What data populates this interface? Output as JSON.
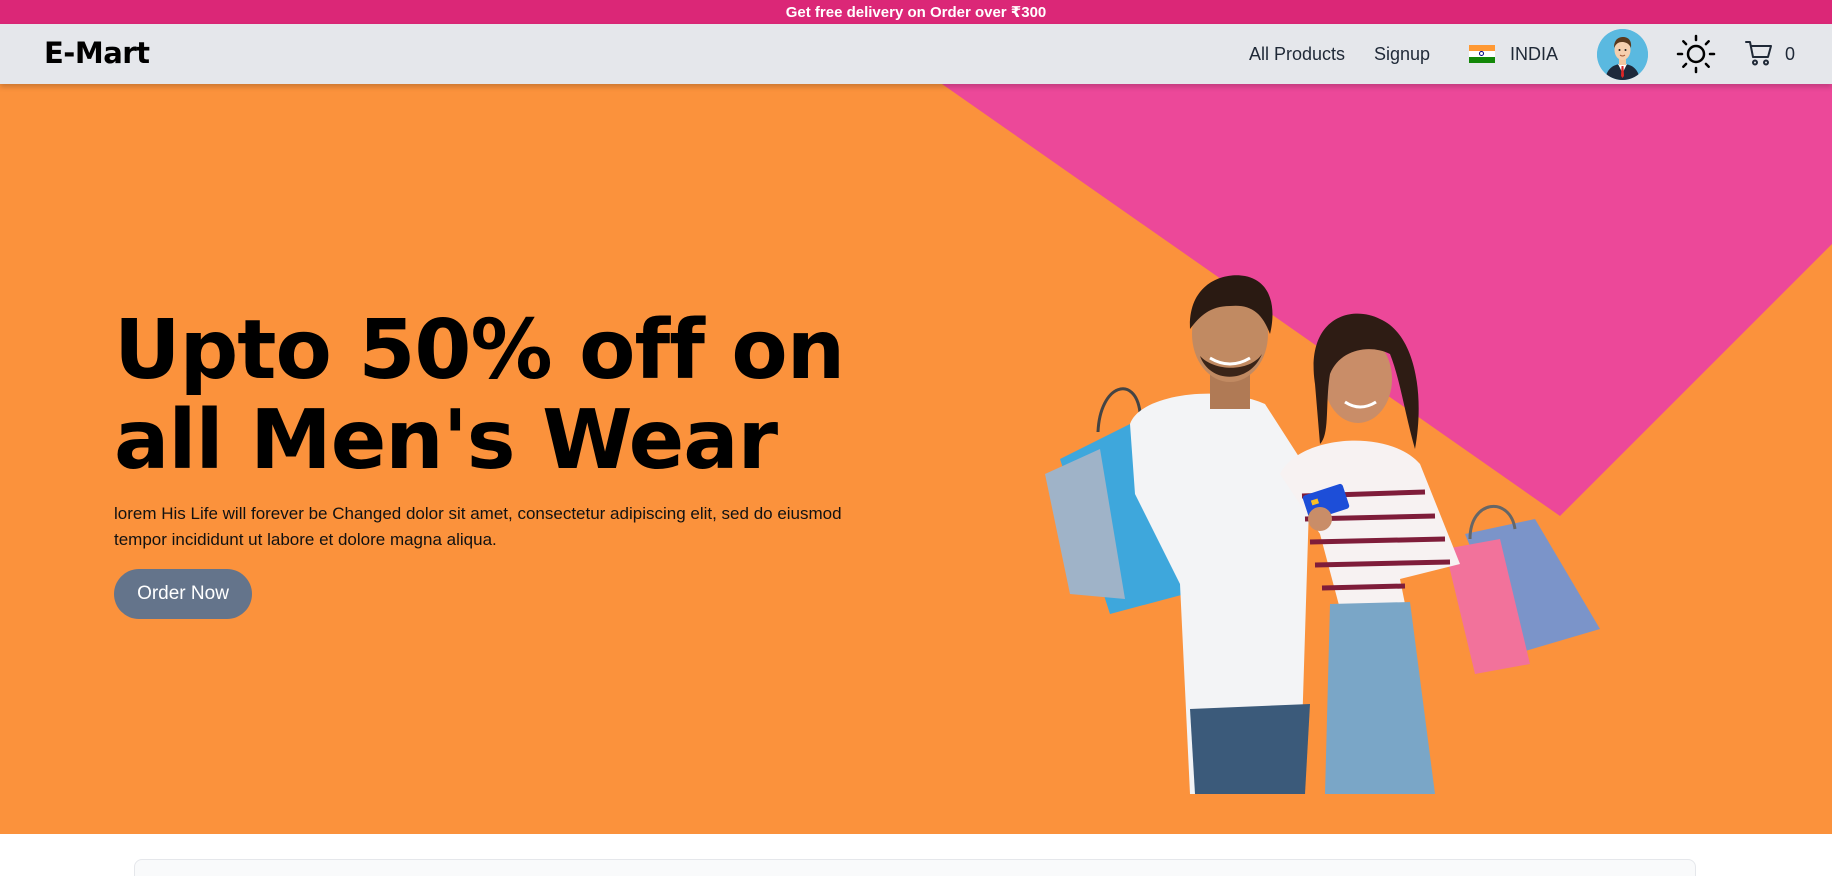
{
  "announcement": {
    "text": "Get free delivery on Order over ₹300"
  },
  "header": {
    "brand": "E-Mart",
    "nav": {
      "all_products": "All Products",
      "signup": "Signup"
    },
    "country": {
      "flag": "india-flag-icon",
      "label": "INDIA"
    },
    "avatar": "user-avatar",
    "theme_icon": "sun-icon",
    "cart": {
      "icon": "cart-icon",
      "count": "0"
    }
  },
  "hero": {
    "headline_line1": "Upto 50% off on",
    "headline_line2": "all Men's Wear",
    "description": "lorem His Life will forever be Changed dolor sit amet, consectetur adipiscing elit, sed do eiusmod tempor incididunt ut labore et dolore magna aliqua.",
    "cta_label": "Order Now",
    "image": "couple-with-shopping-bags-image"
  },
  "colors": {
    "announcement_bg": "#db2777",
    "navbar_bg": "#e5e7eb",
    "hero_bg": "#fb923c",
    "hero_accent": "#ec4899",
    "cta_bg": "#64748b"
  }
}
